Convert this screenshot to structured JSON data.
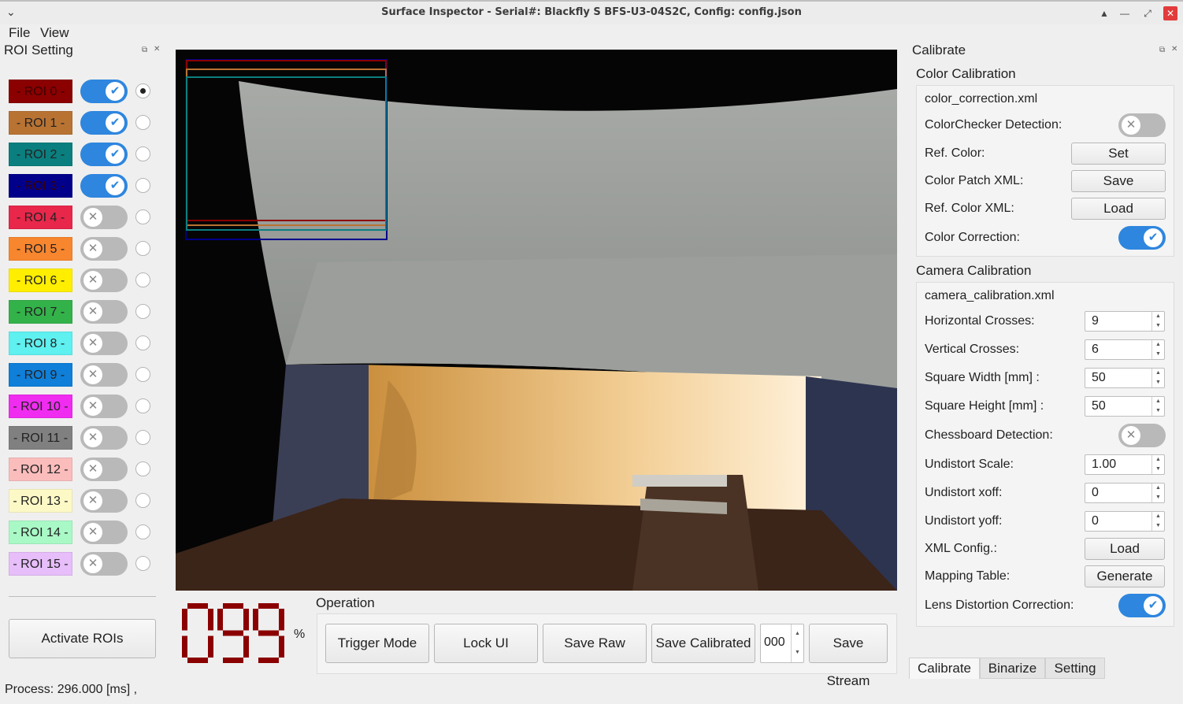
{
  "window": {
    "title": "Surface Inspector - Serial#: Blackfly S BFS-U3-04S2C, Config: config.json"
  },
  "menubar": {
    "items": [
      "File",
      "View"
    ]
  },
  "roi_panel": {
    "title": "ROI Setting",
    "rois": [
      {
        "label": "- ROI 0 -",
        "color": "#8b0000",
        "enabled": true,
        "selected": true
      },
      {
        "label": "- ROI 1 -",
        "color": "#b87333",
        "enabled": true,
        "selected": false
      },
      {
        "label": "- ROI 2 -",
        "color": "#0b7f7f",
        "enabled": true,
        "selected": false
      },
      {
        "label": "- ROI 3 -",
        "color": "#00008b",
        "enabled": true,
        "selected": false
      },
      {
        "label": "- ROI 4 -",
        "color": "#e8274b",
        "enabled": false,
        "selected": false
      },
      {
        "label": "- ROI 5 -",
        "color": "#f7862e",
        "enabled": false,
        "selected": false
      },
      {
        "label": "- ROI 6 -",
        "color": "#ffee00",
        "enabled": false,
        "selected": false
      },
      {
        "label": "- ROI 7 -",
        "color": "#33b24a",
        "enabled": false,
        "selected": false
      },
      {
        "label": "- ROI 8 -",
        "color": "#5ff0f0",
        "enabled": false,
        "selected": false
      },
      {
        "label": "- ROI 9 -",
        "color": "#0f7fd9",
        "enabled": false,
        "selected": false
      },
      {
        "label": "- ROI 10 -",
        "color": "#f02cf0",
        "enabled": false,
        "selected": false
      },
      {
        "label": "- ROI 11 -",
        "color": "#808080",
        "enabled": false,
        "selected": false
      },
      {
        "label": "- ROI 12 -",
        "color": "#fbbcbc",
        "enabled": false,
        "selected": false
      },
      {
        "label": "- ROI 13 -",
        "color": "#fdf9c6",
        "enabled": false,
        "selected": false
      },
      {
        "label": "- ROI 14 -",
        "color": "#a9f9c6",
        "enabled": false,
        "selected": false
      },
      {
        "label": "- ROI 15 -",
        "color": "#e7bdfa",
        "enabled": false,
        "selected": false
      }
    ],
    "activate_button": "Activate ROIs"
  },
  "display": {
    "percent_value": "099",
    "percent_sign": "%"
  },
  "operation": {
    "title": "Operation",
    "trigger_mode": "Trigger Mode",
    "lock_ui": "Lock UI",
    "save_raw": "Save Raw",
    "save_calibrated": "Save Calibrated",
    "counter_value": "000",
    "save_stream": "Save Stream"
  },
  "status": {
    "process": "Process: 296.000 [ms] ,"
  },
  "calibrate_panel": {
    "title": "Calibrate",
    "color_calibration": {
      "title": "Color Calibration",
      "file": "color_correction.xml",
      "colorchecker_label": "ColorChecker Detection:",
      "colorchecker_on": false,
      "ref_color_label": "Ref. Color:",
      "ref_color_button": "Set",
      "patch_xml_label": "Color Patch XML:",
      "patch_xml_button": "Save",
      "ref_color_xml_label": "Ref. Color XML:",
      "ref_color_xml_button": "Load",
      "correction_label": "Color Correction:",
      "correction_on": true
    },
    "camera_calibration": {
      "title": "Camera Calibration",
      "file": "camera_calibration.xml",
      "h_crosses_label": "Horizontal Crosses:",
      "h_crosses": "9",
      "v_crosses_label": "Vertical Crosses:",
      "v_crosses": "6",
      "sq_width_label": "Square Width [mm] :",
      "sq_width": "50",
      "sq_height_label": "Square Height [mm] :",
      "sq_height": "50",
      "chessboard_label": "Chessboard Detection:",
      "chessboard_on": false,
      "undistort_scale_label": "Undistort Scale:",
      "undistort_scale": "1.00",
      "undistort_xoff_label": "Undistort xoff:",
      "undistort_xoff": "0",
      "undistort_yoff_label": "Undistort yoff:",
      "undistort_yoff": "0",
      "xml_config_label": "XML Config.:",
      "xml_config_button": "Load",
      "mapping_table_label": "Mapping Table:",
      "mapping_table_button": "Generate",
      "lens_label": "Lens Distortion Correction:",
      "lens_on": true
    },
    "tabs": [
      "Calibrate",
      "Binarize",
      "Setting"
    ],
    "active_tab": "Calibrate"
  }
}
